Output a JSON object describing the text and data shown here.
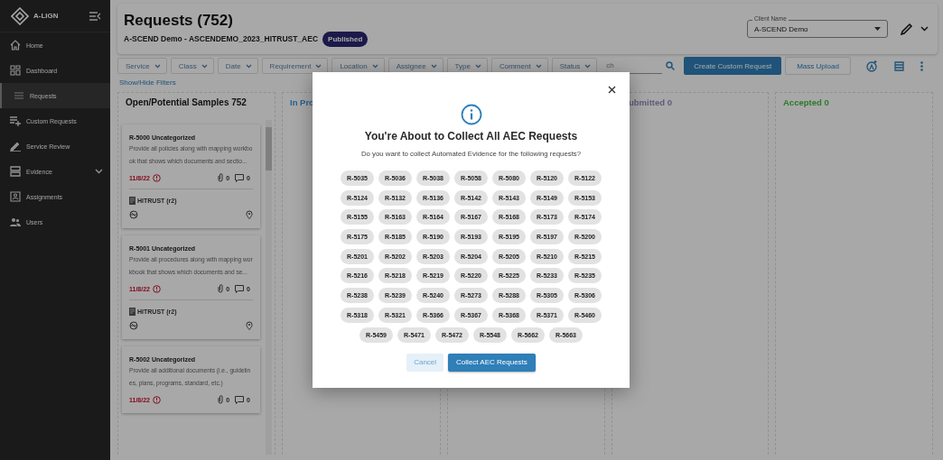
{
  "sidebar": {
    "brand": "A-LIGN",
    "items": [
      {
        "label": "Home",
        "kind": "home",
        "selected": false
      },
      {
        "label": "Dashboard",
        "kind": "dashboard",
        "selected": false
      },
      {
        "label": "Requests",
        "kind": "list",
        "selected": true
      },
      {
        "label": "Custom Requests",
        "kind": "listadd",
        "selected": false
      },
      {
        "label": "Service Review",
        "kind": "pencil",
        "selected": false
      },
      {
        "label": "Evidence",
        "kind": "evidence",
        "selected": false,
        "expandable": true
      },
      {
        "label": "Assignments",
        "kind": "assign",
        "selected": false
      },
      {
        "label": "Users",
        "kind": "users",
        "selected": false
      }
    ]
  },
  "header": {
    "title": "Requests (752)",
    "subtitle": "A-SCEND Demo - ASCENDEMO_2023_HITRUST_AEC",
    "badge": "Published",
    "client": {
      "label": "Client Name",
      "value": "A-SCEND Demo"
    }
  },
  "filters": [
    "Service",
    "Class",
    "Date",
    "Requirement",
    "Location",
    "Assignee",
    "Type",
    "Comment",
    "Status"
  ],
  "show_hide": "Show/Hide Filters",
  "search": {
    "placeholder": "ch"
  },
  "actions": {
    "primary": "Create Custom Request",
    "secondary": "Mass Upload"
  },
  "columns": [
    {
      "title": "Open/Potential Samples 752",
      "color": "#111111",
      "cards": [
        {
          "title": "R-5000 Uncategorized",
          "description": "Provide all policies along with mapping workbook that shows which documents and sectio...",
          "date": "11/8/22",
          "attachments": "0",
          "comments": "0",
          "framework": "HITRUST (r2)"
        },
        {
          "title": "R-5001 Uncategorized",
          "description": "Provide all procedures along with mapping workbook that shows which documents and se...",
          "date": "11/8/22",
          "attachments": "0",
          "comments": "0",
          "framework": "HITRUST (r2)"
        },
        {
          "title": "R-5002 Uncategorized",
          "description": "Provide all additional documents (i.e., guidelines, plans, programs, standard, etc.)",
          "date": "11/8/22",
          "attachments": "0",
          "comments": "0"
        }
      ]
    },
    {
      "title": "In Pro",
      "color": "#23628f"
    },
    {},
    {
      "title": "ubmitted 0",
      "color": "#5e5b7a"
    },
    {
      "title": "Accepted 0",
      "color": "#2b7a2b"
    }
  ],
  "modal": {
    "title": "You're About to Collect All AEC Requests",
    "message": "Do you want to collect Automated Evidence for the following requests?",
    "requests": [
      "R-5035",
      "R-5036",
      "R-5038",
      "R-5058",
      "R-5080",
      "R-5120",
      "R-5122",
      "R-5124",
      "R-5132",
      "R-5136",
      "R-5142",
      "R-5143",
      "R-5149",
      "R-5153",
      "R-5155",
      "R-5163",
      "R-5164",
      "R-5167",
      "R-5168",
      "R-5173",
      "R-5174",
      "R-5175",
      "R-5185",
      "R-5190",
      "R-5193",
      "R-5195",
      "R-5197",
      "R-5200",
      "R-5201",
      "R-5202",
      "R-5203",
      "R-5204",
      "R-5205",
      "R-5210",
      "R-5215",
      "R-5216",
      "R-5218",
      "R-5219",
      "R-5220",
      "R-5225",
      "R-5233",
      "R-5235",
      "R-5238",
      "R-5239",
      "R-5240",
      "R-5273",
      "R-5288",
      "R-5305",
      "R-5306",
      "R-5318",
      "R-5321",
      "R-5366",
      "R-5367",
      "R-5368",
      "R-5371",
      "R-5460",
      "R-5459",
      "R-5471",
      "R-5472",
      "R-5548",
      "R-5662",
      "R-5663"
    ],
    "cancel": "Cancel",
    "confirm": "Collect AEC Requests"
  }
}
